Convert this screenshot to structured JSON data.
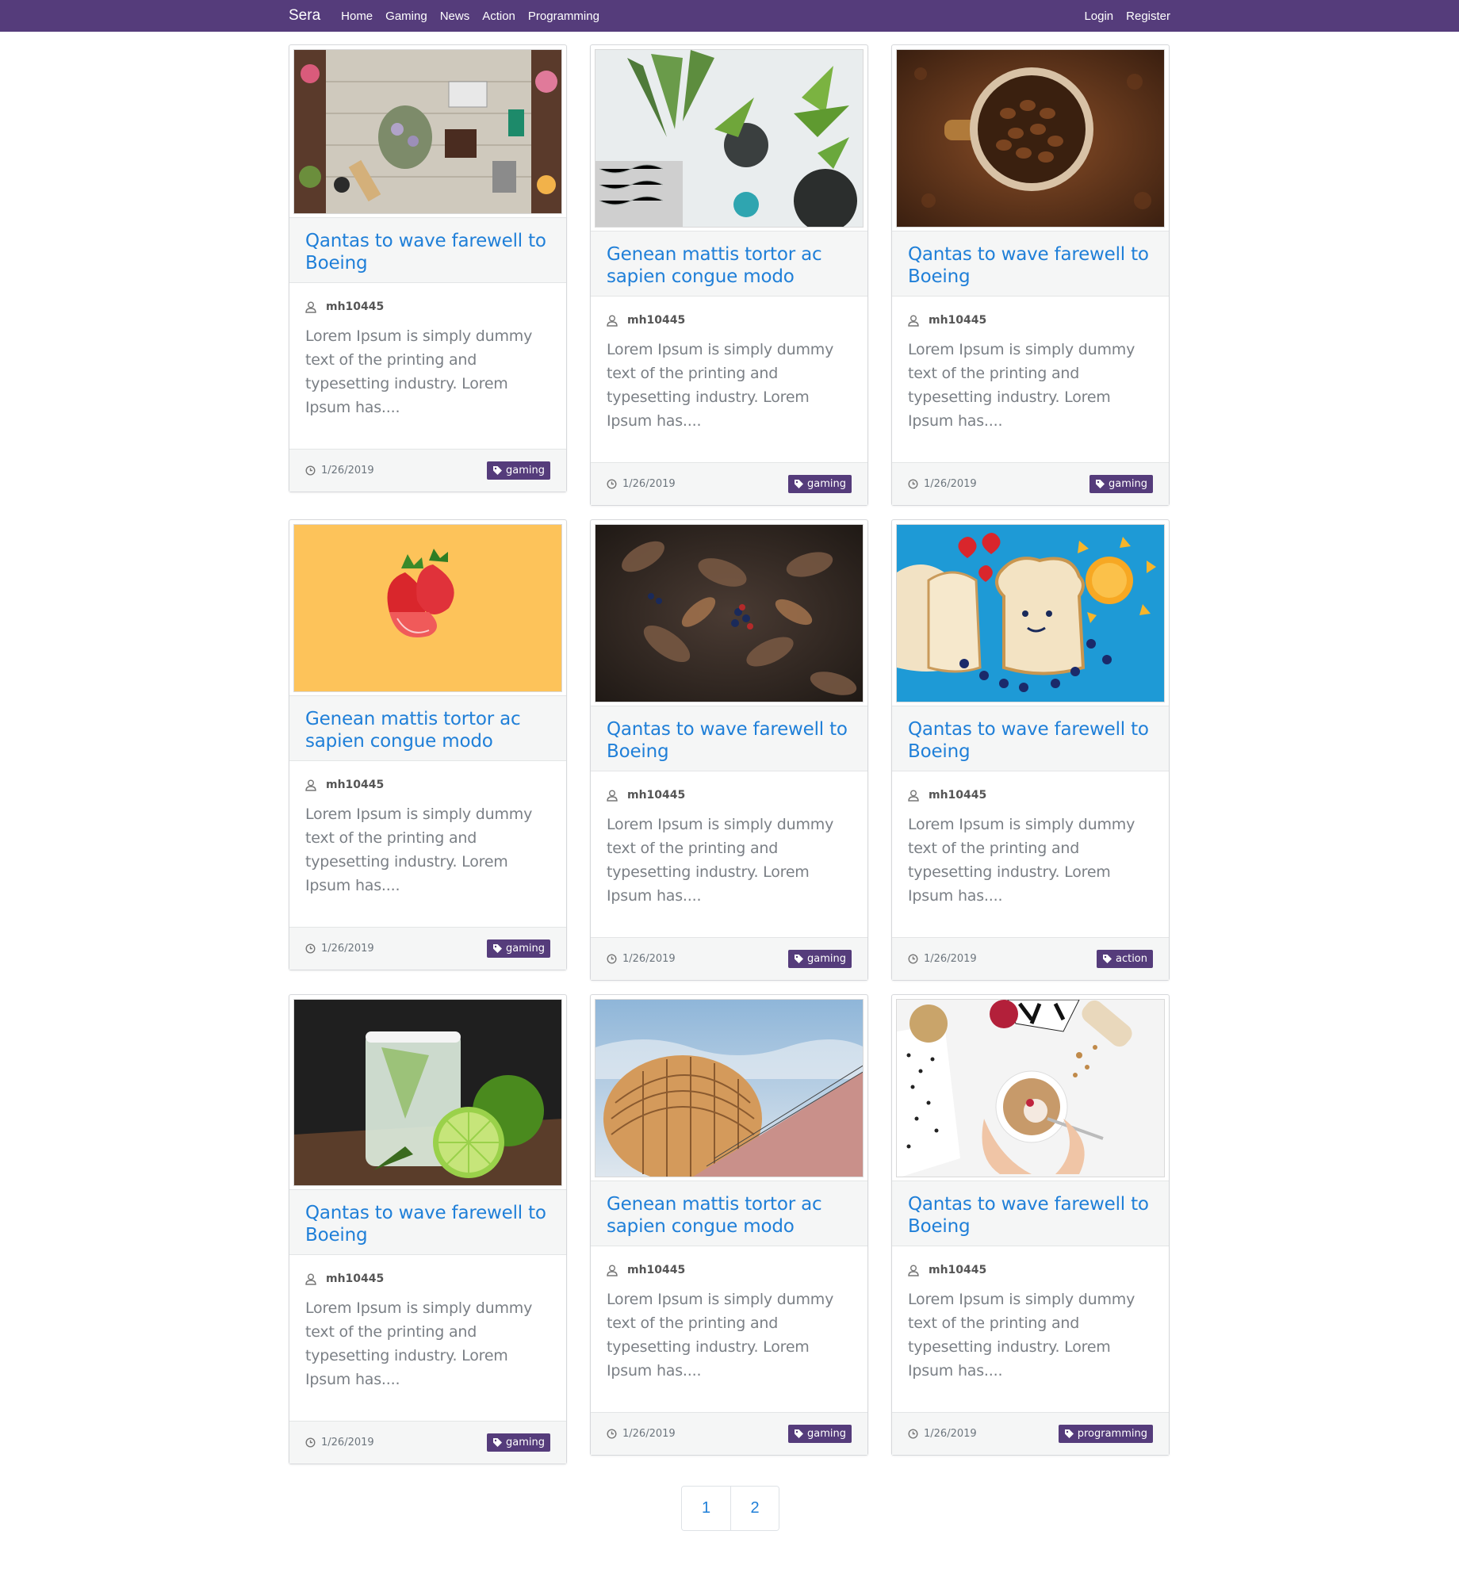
{
  "navbar": {
    "brand": "Sera",
    "links": [
      "Home",
      "Gaming",
      "News",
      "Action",
      "Programming"
    ],
    "login": "Login",
    "register": "Register",
    "bg_color": "#553c7b"
  },
  "posts": [
    {
      "title": "Qantas to wave farewell to Boeing",
      "author": "mh10445",
      "excerpt": "Lorem Ipsum is simply dummy text of the printing and typesetting industry. Lorem Ipsum has....",
      "date": "1/26/2019",
      "tag": "gaming",
      "image": "flatlay-desk-flowers"
    },
    {
      "title": "Genean mattis tortor ac sapien congue modo",
      "author": "mh10445",
      "excerpt": "Lorem Ipsum is simply dummy text of the printing and typesetting industry. Lorem Ipsum has....",
      "date": "1/26/2019",
      "tag": "gaming",
      "image": "potted-plants"
    },
    {
      "title": "Qantas to wave farewell to Boeing",
      "author": "mh10445",
      "excerpt": "Lorem Ipsum is simply dummy text of the printing and typesetting industry. Lorem Ipsum has....",
      "date": "1/26/2019",
      "tag": "gaming",
      "image": "coffee-beans-cup"
    },
    {
      "title": "Genean mattis tortor ac sapien congue modo",
      "author": "mh10445",
      "excerpt": "Lorem Ipsum is simply dummy text of the printing and typesetting industry. Lorem Ipsum has....",
      "date": "1/26/2019",
      "tag": "gaming",
      "image": "strawberries"
    },
    {
      "title": "Qantas to wave farewell to Boeing",
      "author": "mh10445",
      "excerpt": "Lorem Ipsum is simply dummy text of the printing and typesetting industry. Lorem Ipsum has....",
      "date": "1/26/2019",
      "tag": "gaming",
      "image": "dark-leaves-berries"
    },
    {
      "title": "Qantas to wave farewell to Boeing",
      "author": "mh10445",
      "excerpt": "Lorem Ipsum is simply dummy text of the printing and typesetting industry. Lorem Ipsum has....",
      "date": "1/26/2019",
      "tag": "action",
      "image": "bread-fruit-blue"
    },
    {
      "title": "Qantas to wave farewell to Boeing",
      "author": "mh10445",
      "excerpt": "Lorem Ipsum is simply dummy text of the printing and typesetting industry. Lorem Ipsum has....",
      "date": "1/26/2019",
      "tag": "gaming",
      "image": "lime-drink"
    },
    {
      "title": "Genean mattis tortor ac sapien congue modo",
      "author": "mh10445",
      "excerpt": "Lorem Ipsum is simply dummy text of the printing and typesetting industry. Lorem Ipsum has....",
      "date": "1/26/2019",
      "tag": "gaming",
      "image": "wooden-architecture"
    },
    {
      "title": "Qantas to wave farewell to Boeing",
      "author": "mh10445",
      "excerpt": "Lorem Ipsum is simply dummy text of the printing and typesetting industry. Lorem Ipsum has....",
      "date": "1/26/2019",
      "tag": "programming",
      "image": "granola-breakfast"
    }
  ],
  "pagination": {
    "pages": [
      "1",
      "2"
    ]
  },
  "colors": {
    "accent": "#553c7b",
    "link": "#1f7fd8"
  }
}
